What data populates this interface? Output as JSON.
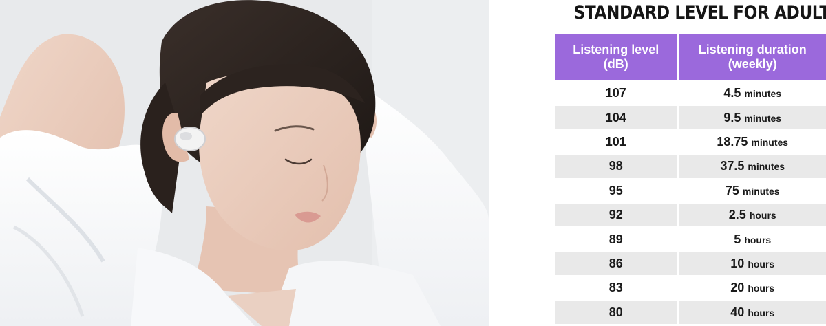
{
  "title": "STANDARD LEVEL FOR ADULT",
  "photo": {
    "icon": "woman-wearing-earbud-photo"
  },
  "colors": {
    "header_background": "#9b69dc",
    "row_shade": "#e9e9e9",
    "text": "#1a1a1a"
  },
  "table": {
    "headers": {
      "level": [
        "Listening level",
        "(dB)"
      ],
      "duration": [
        "Listening duration",
        "(weekly)"
      ]
    },
    "rows": [
      {
        "level": "107",
        "amount": "4.5",
        "unit": "minutes"
      },
      {
        "level": "104",
        "amount": "9.5",
        "unit": "minutes"
      },
      {
        "level": "101",
        "amount": "18.75",
        "unit": "minutes"
      },
      {
        "level": "98",
        "amount": "37.5",
        "unit": "minutes"
      },
      {
        "level": "95",
        "amount": "75",
        "unit": "minutes"
      },
      {
        "level": "92",
        "amount": "2.5",
        "unit": "hours"
      },
      {
        "level": "89",
        "amount": "5",
        "unit": "hours"
      },
      {
        "level": "86",
        "amount": "10",
        "unit": "hours"
      },
      {
        "level": "83",
        "amount": "20",
        "unit": "hours"
      },
      {
        "level": "80",
        "amount": "40",
        "unit": "hours"
      }
    ]
  }
}
